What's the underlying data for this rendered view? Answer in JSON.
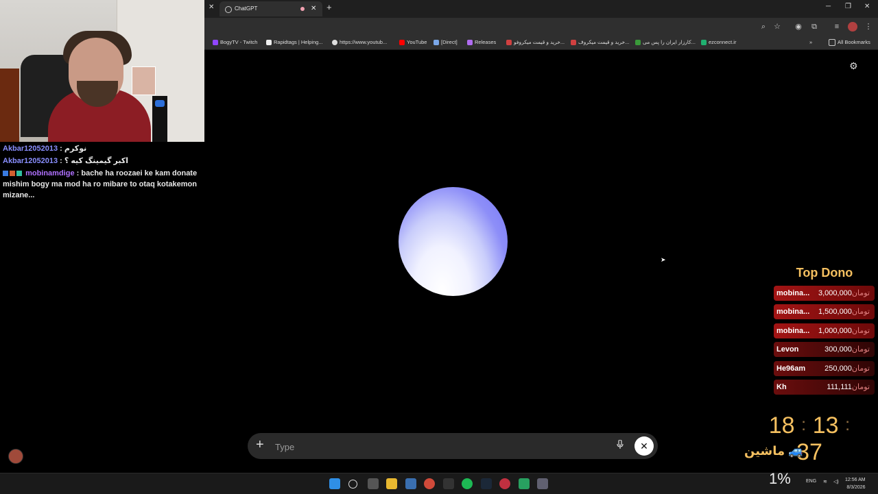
{
  "browser": {
    "tab_title": "ChatGPT",
    "bookmarks": [
      {
        "label": "BogyTV - Twitch",
        "icon": "twitch-icon",
        "color": "#9146ff"
      },
      {
        "label": "Rapidtags | Helping...",
        "icon": "rapidtags-icon",
        "color": "#eeeeee"
      },
      {
        "label": "https://www.youtub...",
        "icon": "google-icon",
        "color": "#dddddd"
      },
      {
        "label": "YouTube",
        "icon": "youtube-icon",
        "color": "#ff0000"
      },
      {
        "label": "[Direct]",
        "icon": "headphones-icon",
        "color": "#7aa7e8"
      },
      {
        "label": "Releases",
        "icon": "releases-icon",
        "color": "#b06cf0"
      },
      {
        "label": "خرید و قیمت میکروفو...",
        "icon": "shop-icon",
        "color": "#d04040"
      },
      {
        "label": "خرید و قیمت میکروف...",
        "icon": "shop-icon",
        "color": "#d04040"
      },
      {
        "label": "کارزار ایران را پس می...",
        "icon": "flag-icon",
        "color": "#3a9a3a"
      },
      {
        "label": "ezconnect.ir",
        "icon": "ezconnect-icon",
        "color": "#20b070"
      }
    ],
    "all_bookmarks": "All Bookmarks"
  },
  "chat": [
    {
      "user": "Akbar12052013",
      "sep": " : ",
      "text": "نوکرم",
      "color": "#8a8fff"
    },
    {
      "user": "Akbar12052013",
      "sep": " : ",
      "text": "اکبر گیمینگ کیه ؟",
      "color": "#8a8fff"
    },
    {
      "user": "mobinamdige",
      "sep": " : ",
      "text": "bache ha roozaei ke kam donate mishim bogy ma mod ha ro mibare to otaq kotakemon mizane...",
      "color": "#b071ff"
    }
  ],
  "voice": {
    "input_placeholder": "Type"
  },
  "donations": {
    "title": "Top Dono",
    "currency": "تومان",
    "rows": [
      {
        "name": "mobina...",
        "amount": "3,000,000"
      },
      {
        "name": "mobina...",
        "amount": "1,500,000"
      },
      {
        "name": "mobina...",
        "amount": "1,000,000"
      },
      {
        "name": "Levon",
        "amount": "300,000"
      },
      {
        "name": "He96am",
        "amount": "250,000"
      },
      {
        "name": "Kh",
        "amount": "111,111"
      }
    ]
  },
  "timer": {
    "h": "18",
    "m": "13",
    "s": "37"
  },
  "car_label": "ماشین",
  "overlay_percent": "1%",
  "taskbar": {
    "lang": "ENG",
    "time": "12:56 AM",
    "date": "8/3/2026"
  }
}
